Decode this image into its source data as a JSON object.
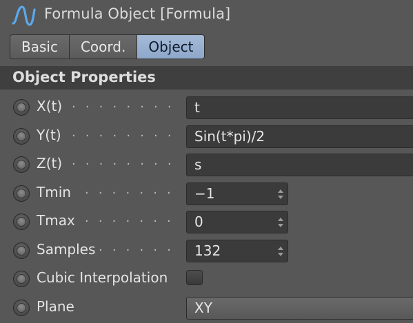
{
  "window": {
    "title": "Formula Object [Formula]",
    "icon": "formula-sine-icon"
  },
  "tabs": [
    {
      "label": "Basic",
      "active": false
    },
    {
      "label": "Coord.",
      "active": false
    },
    {
      "label": "Object",
      "active": true
    }
  ],
  "section": {
    "title": "Object Properties"
  },
  "properties": {
    "xt": {
      "label": "X(t)",
      "dots": ". . . . . . . . . . . . . . . . .",
      "value": "t"
    },
    "yt": {
      "label": "Y(t)",
      "dots": ". . . . . . . . . . . . . . . . .",
      "value": "Sin(t*pi)/2"
    },
    "zt": {
      "label": "Z(t)",
      "dots": ". . . . . . . . . . . . . . . . .",
      "value": "s"
    },
    "tmin": {
      "label": "Tmin",
      "dots": ". . . . . . . . . . . . . . .",
      "value": "−1"
    },
    "tmax": {
      "label": "Tmax",
      "dots": ". . . . . . . . . . . . . . .",
      "value": "0"
    },
    "samples": {
      "label": "Samples",
      "dots": ". . . . . . . . . . .",
      "value": "132"
    },
    "cubic": {
      "label": "Cubic Interpolation",
      "checked": false
    },
    "plane": {
      "label": "Plane",
      "value": "XY"
    }
  },
  "colors": {
    "panel_bg": "#575757",
    "section_bg": "#3f3f3f",
    "field_bg": "#3b3b3b",
    "tab_active": "#8ea8cb"
  }
}
